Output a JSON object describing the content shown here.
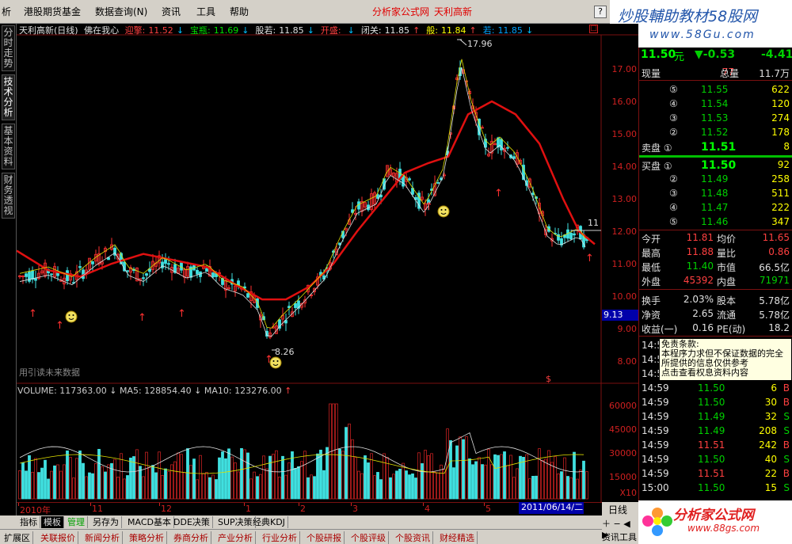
{
  "menubar": {
    "items": [
      "析",
      "港股期货基金",
      "数据查询(N)",
      "资讯",
      "工具",
      "帮助"
    ],
    "center_left": "分析家公式网",
    "center_right": "天利高新",
    "help": "?"
  },
  "brand": {
    "title": "炒股輔助教材58股网",
    "url": "www.58Gu.com"
  },
  "left_tabs": [
    "分时走势",
    "技术分析",
    "基本资料",
    "财务透视"
  ],
  "chart": {
    "info": {
      "name": "天利高新(日线)",
      "formula": "佛在我心",
      "items": [
        {
          "label": "迎擎:",
          "value": "11.52",
          "arrow": "↓",
          "color": "#ff4040"
        },
        {
          "label": "宝瓶:",
          "value": "11.69",
          "arrow": "↓",
          "color": "#00e000"
        },
        {
          "label": "股若:",
          "value": "11.85",
          "arrow": "↓",
          "color": "#e0e0e0"
        },
        {
          "label": "开盛:",
          "value": "",
          "arrow": "↓",
          "color": "#ff4040"
        },
        {
          "label": "闭关:",
          "value": "11.85",
          "arrow": "↑",
          "color": "#e0e0e0"
        },
        {
          "label": "般:",
          "value": "11.84",
          "arrow": "↑",
          "color": "#ffff00"
        },
        {
          "label": "若:",
          "value": "11.85",
          "arrow": "↓",
          "color": "#00a0ff"
        }
      ]
    },
    "price_axis": [
      "17.00",
      "16.00",
      "15.00",
      "14.00",
      "13.00",
      "12.00",
      "11.00",
      "10.00",
      "9.00",
      "8.00"
    ],
    "cursor_price": "9.13",
    "high_label": "17.96",
    "low_label": "8.26",
    "last_label": "11",
    "watermark": "用引读未来数据",
    "dollar_sign": "$",
    "volume": {
      "info": "VOLUME: 117363.00",
      "ma5": "MA5: 128854.40",
      "ma10": "MA10: 123276.00",
      "axis": [
        "60000",
        "45000",
        "30000",
        "15000"
      ],
      "unit": "X10"
    },
    "dates": [
      "2010年",
      "11",
      "12",
      "1",
      "2",
      "3",
      "4",
      "5"
    ],
    "cursor_date": "2011/06/14/二"
  },
  "quote": {
    "price": "11.50",
    "unit": "元",
    "change": "▼-0.53",
    "pct": "-4.41",
    "now_vol_label": "现量",
    "now_vol": "77",
    "total_label": "总量",
    "total": "11.7万",
    "sell": [
      {
        "lvl": "⑤",
        "price": "11.55",
        "vol": "622"
      },
      {
        "lvl": "④",
        "price": "11.54",
        "vol": "120"
      },
      {
        "lvl": "③",
        "price": "11.53",
        "vol": "274"
      },
      {
        "lvl": "②",
        "price": "11.52",
        "vol": "178"
      },
      {
        "lvl": "卖盘 ①",
        "price": "11.51",
        "vol": "8"
      }
    ],
    "buy": [
      {
        "lvl": "买盘 ①",
        "price": "11.50",
        "vol": "92"
      },
      {
        "lvl": "②",
        "price": "11.49",
        "vol": "258"
      },
      {
        "lvl": "③",
        "price": "11.48",
        "vol": "511"
      },
      {
        "lvl": "④",
        "price": "11.47",
        "vol": "222"
      },
      {
        "lvl": "⑤",
        "price": "11.46",
        "vol": "347"
      }
    ],
    "stats": [
      {
        "l1": "今开",
        "v1": "11.81",
        "l2": "均价",
        "v2": "11.65"
      },
      {
        "l1": "最高",
        "v1": "11.88",
        "l2": "量比",
        "v2": "0.86"
      },
      {
        "l1": "最低",
        "v1": "11.40",
        "l2": "市值",
        "v2": "66.5亿"
      },
      {
        "l1": "外盘",
        "v1": "45392",
        "l2": "内盘",
        "v2": "71971"
      },
      {
        "l1": "换手",
        "v1": "2.03%",
        "l2": "股本",
        "v2": "5.78亿"
      },
      {
        "l1": "净资",
        "v1": "2.65",
        "l2": "流通",
        "v2": "5.78亿"
      },
      {
        "l1": "收益(一)",
        "v1": "0.16",
        "l2": "PE(动)",
        "v2": "18.2"
      }
    ],
    "ticks": [
      {
        "t": "14:59",
        "p": "11.50",
        "v": "6",
        "d": "B"
      },
      {
        "t": "14:59",
        "p": "11.50",
        "v": "30",
        "d": "B"
      },
      {
        "t": "14:59",
        "p": "11.49",
        "v": "32",
        "d": "S"
      },
      {
        "t": "14:59",
        "p": "11.49",
        "v": "208",
        "d": "S"
      },
      {
        "t": "14:59",
        "p": "11.51",
        "v": "242",
        "d": "B"
      },
      {
        "t": "14:59",
        "p": "11.50",
        "v": "40",
        "d": "S"
      },
      {
        "t": "14:59",
        "p": "11.51",
        "v": "22",
        "d": "B"
      },
      {
        "t": "15:00",
        "p": "11.50",
        "v": "15",
        "d": "S"
      }
    ],
    "tick_times_hidden": [
      "14:5",
      "14:5",
      "14:5"
    ]
  },
  "tooltip": {
    "title": "免责条款:",
    "lines": [
      "本程序力求但不保证数据的完全",
      "所提供的信息仅供参考",
      "点击查看权息资料内容"
    ]
  },
  "bottom_tabs": [
    "指标",
    "模板",
    "管理",
    "另存为",
    "MACD基本",
    "DDE决策",
    "SUP决策",
    "经典KDJ"
  ],
  "bottom_tabs2": [
    "扩展区",
    "关联报价",
    "新闻分析",
    "策略分析",
    "券商分析",
    "产业分析",
    "行业分析",
    "个股研报",
    "个股评级",
    "个股资讯",
    "财经精选"
  ],
  "right_bottom": {
    "label": "日线",
    "extra": "资讯工具"
  },
  "logo2": {
    "text": "分析家公式网",
    "url": "www.88gs.com"
  }
}
